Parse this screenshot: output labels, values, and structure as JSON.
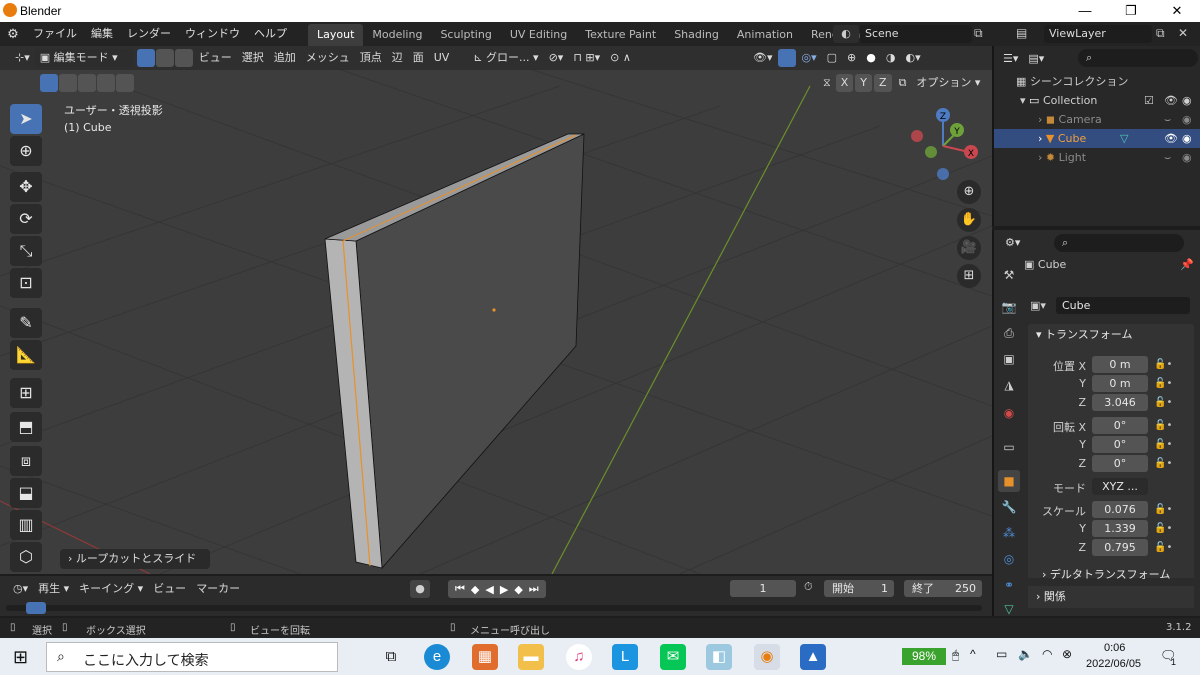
{
  "window": {
    "title": "Blender",
    "controls": [
      "—",
      "❐",
      "✕"
    ]
  },
  "menu": [
    "ファイル",
    "編集",
    "レンダー",
    "ウィンドウ",
    "ヘルプ"
  ],
  "workspaces": [
    "Layout",
    "Modeling",
    "Sculpting",
    "UV Editing",
    "Texture Paint",
    "Shading",
    "Animation",
    "Rendering"
  ],
  "scene": {
    "label": "Scene",
    "view_layer": "ViewLayer"
  },
  "viewport_header": {
    "mode": "編集モード",
    "menus": [
      "ビュー",
      "選択",
      "追加",
      "メッシュ",
      "頂点",
      "辺",
      "面",
      "UV"
    ],
    "transform_orient": "グロー...",
    "options": "オプション",
    "axes": [
      "X",
      "Y",
      "Z"
    ]
  },
  "viewport_info": {
    "line1": "ユーザー・透視投影",
    "line2": "(1) Cube"
  },
  "last_op": "ループカットとスライド",
  "gizmo": {
    "z": "Z",
    "y": "Y",
    "x": "X"
  },
  "outliner": {
    "scene_collection": "シーンコレクション",
    "items": [
      {
        "name": "Collection"
      },
      {
        "name": "Camera"
      },
      {
        "name": "Cube"
      },
      {
        "name": "Light"
      }
    ]
  },
  "properties": {
    "object_name": "Cube",
    "data_name": "Cube",
    "panel": "トランスフォーム",
    "location": {
      "label": "位置 X",
      "x": "0 m",
      "y": "0 m",
      "z": "3.046"
    },
    "rotation": {
      "label": "回転 X",
      "x": "0°",
      "y": "0°",
      "z": "0°"
    },
    "mode_label": "モード",
    "mode": "XYZ ...",
    "scale": {
      "label": "スケール",
      "x": "0.076",
      "y": "1.339",
      "z": "0.795"
    },
    "axis_y": "Y",
    "axis_z": "Z",
    "delta": "デルタトランスフォーム",
    "relations": "関係"
  },
  "timeline": {
    "menus": [
      "再生",
      "キーイング",
      "ビュー",
      "マーカー"
    ],
    "current_frame": "1",
    "start_label": "開始",
    "start": "1",
    "end_label": "終了",
    "end": "250"
  },
  "statusbar": {
    "select": "選択",
    "box": "ボックス選択",
    "rotate": "ビューを回転",
    "menu": "メニュー呼び出し",
    "version": "3.1.2"
  },
  "taskbar": {
    "search": "ここに入力して検索",
    "battery": "98%",
    "time": "0:06",
    "date": "2022/06/05",
    "notif": "1"
  },
  "colors": {
    "accent": "#4772b3",
    "selected": "#e8902a",
    "viewport": "#3d3d3d"
  }
}
